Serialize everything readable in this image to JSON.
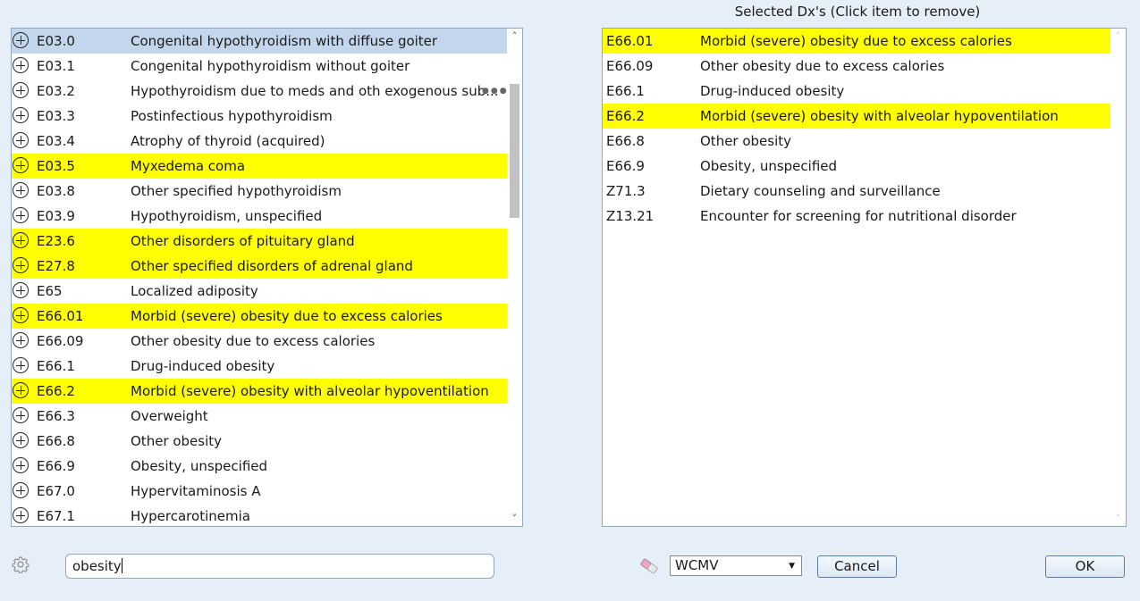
{
  "right_panel": {
    "title": "Selected Dx's (Click item to remove)"
  },
  "left_list": {
    "more_icon": "ellipsis-icon",
    "items": [
      {
        "code": "E03.0",
        "desc": "Congenital hypothyroidism with diffuse goiter",
        "state": "selected"
      },
      {
        "code": "E03.1",
        "desc": "Congenital hypothyroidism without goiter",
        "state": ""
      },
      {
        "code": "E03.2",
        "desc": "Hypothyroidism due to meds and oth exogenous sub...",
        "state": "",
        "more": true
      },
      {
        "code": "E03.3",
        "desc": "Postinfectious hypothyroidism",
        "state": ""
      },
      {
        "code": "E03.4",
        "desc": "Atrophy of thyroid (acquired)",
        "state": ""
      },
      {
        "code": "E03.5",
        "desc": "Myxedema coma",
        "state": "highlight"
      },
      {
        "code": "E03.8",
        "desc": "Other specified hypothyroidism",
        "state": ""
      },
      {
        "code": "E03.9",
        "desc": "Hypothyroidism, unspecified",
        "state": ""
      },
      {
        "code": "E23.6",
        "desc": "Other disorders of pituitary gland",
        "state": "highlight"
      },
      {
        "code": "E27.8",
        "desc": "Other specified disorders of adrenal gland",
        "state": "highlight"
      },
      {
        "code": "E65",
        "desc": "Localized adiposity",
        "state": ""
      },
      {
        "code": "E66.01",
        "desc": "Morbid (severe) obesity due to excess calories",
        "state": "highlight"
      },
      {
        "code": "E66.09",
        "desc": "Other obesity due to excess calories",
        "state": ""
      },
      {
        "code": "E66.1",
        "desc": "Drug-induced obesity",
        "state": ""
      },
      {
        "code": "E66.2",
        "desc": "Morbid (severe) obesity with alveolar hypoventilation",
        "state": "highlight"
      },
      {
        "code": "E66.3",
        "desc": "Overweight",
        "state": ""
      },
      {
        "code": "E66.8",
        "desc": "Other obesity",
        "state": ""
      },
      {
        "code": "E66.9",
        "desc": "Obesity, unspecified",
        "state": ""
      },
      {
        "code": "E67.0",
        "desc": "Hypervitaminosis A",
        "state": ""
      },
      {
        "code": "E67.1",
        "desc": "Hypercarotinemia",
        "state": ""
      }
    ]
  },
  "right_list": {
    "items": [
      {
        "code": "E66.01",
        "desc": "Morbid (severe) obesity due to excess calories",
        "state": "highlight"
      },
      {
        "code": "E66.09",
        "desc": "Other obesity due to excess calories",
        "state": ""
      },
      {
        "code": "E66.1",
        "desc": "Drug-induced obesity",
        "state": ""
      },
      {
        "code": "E66.2",
        "desc": "Morbid (severe) obesity with alveolar hypoventilation",
        "state": "highlight"
      },
      {
        "code": "E66.8",
        "desc": "Other obesity",
        "state": ""
      },
      {
        "code": "E66.9",
        "desc": "Obesity, unspecified",
        "state": ""
      },
      {
        "code": "Z71.3",
        "desc": "Dietary counseling and surveillance",
        "state": ""
      },
      {
        "code": "Z13.21",
        "desc": "Encounter for screening for nutritional disorder",
        "state": ""
      }
    ]
  },
  "search": {
    "value": "obesity"
  },
  "footer": {
    "select_value": "WCMV",
    "cancel_label": "Cancel",
    "ok_label": "OK"
  },
  "icons": {
    "row_add": "plus-circle-icon",
    "settings": "gear-icon",
    "eraser": "eraser-icon",
    "scroll_up": "chevron-up-icon",
    "scroll_down": "chevron-down-icon"
  },
  "colors": {
    "highlight": "#ffff00",
    "selected": "#c3d6ec",
    "background": "#e6eef8"
  }
}
